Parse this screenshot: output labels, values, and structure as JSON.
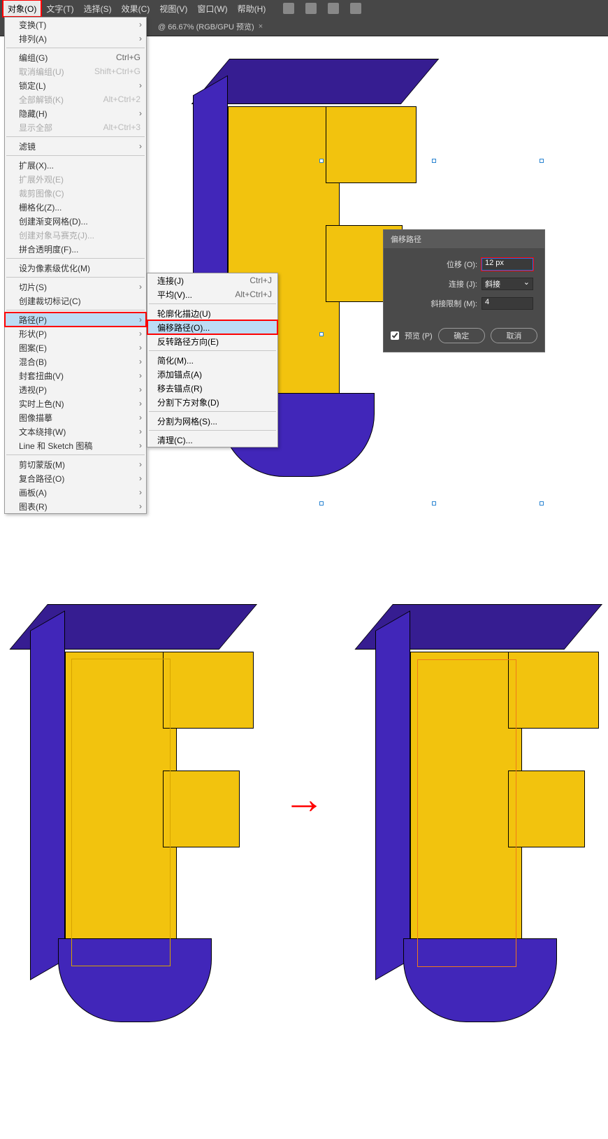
{
  "menubar": {
    "items": [
      "对象(O)",
      "文字(T)",
      "选择(S)",
      "效果(C)",
      "视图(V)",
      "窗口(W)",
      "帮助(H)"
    ]
  },
  "tab": {
    "label": "@ 66.67% (RGB/GPU 预览)",
    "close": "×"
  },
  "dropdown": {
    "items": [
      {
        "label": "变换(T)",
        "arrow": true
      },
      {
        "label": "排列(A)",
        "arrow": true
      },
      {
        "sep": true
      },
      {
        "label": "编组(G)",
        "sc": "Ctrl+G"
      },
      {
        "label": "取消编组(U)",
        "sc": "Shift+Ctrl+G",
        "disabled": true
      },
      {
        "label": "锁定(L)",
        "arrow": true
      },
      {
        "label": "全部解锁(K)",
        "sc": "Alt+Ctrl+2",
        "disabled": true
      },
      {
        "label": "隐藏(H)",
        "arrow": true
      },
      {
        "label": "显示全部",
        "sc": "Alt+Ctrl+3",
        "disabled": true
      },
      {
        "sep": true
      },
      {
        "label": "滤镜",
        "arrow": true
      },
      {
        "sep": true
      },
      {
        "label": "扩展(X)..."
      },
      {
        "label": "扩展外观(E)",
        "disabled": true
      },
      {
        "label": "裁剪图像(C)",
        "disabled": true
      },
      {
        "label": "栅格化(Z)..."
      },
      {
        "label": "创建渐变网格(D)..."
      },
      {
        "label": "创建对象马赛克(J)...",
        "disabled": true
      },
      {
        "label": "拼合透明度(F)..."
      },
      {
        "sep": true
      },
      {
        "label": "设为像素级优化(M)"
      },
      {
        "sep": true
      },
      {
        "label": "切片(S)",
        "arrow": true
      },
      {
        "label": "创建裁切标记(C)"
      },
      {
        "sep": true
      },
      {
        "label": "路径(P)",
        "arrow": true,
        "hover": true,
        "highlight": true
      },
      {
        "label": "形状(P)",
        "arrow": true
      },
      {
        "label": "图案(E)",
        "arrow": true
      },
      {
        "label": "混合(B)",
        "arrow": true
      },
      {
        "label": "封套扭曲(V)",
        "arrow": true
      },
      {
        "label": "透视(P)",
        "arrow": true
      },
      {
        "label": "实时上色(N)",
        "arrow": true
      },
      {
        "label": "图像描摹",
        "arrow": true
      },
      {
        "label": "文本绕排(W)",
        "arrow": true
      },
      {
        "label": "Line 和 Sketch 图稿",
        "arrow": true
      },
      {
        "sep": true
      },
      {
        "label": "剪切蒙版(M)",
        "arrow": true
      },
      {
        "label": "复合路径(O)",
        "arrow": true
      },
      {
        "label": "画板(A)",
        "arrow": true
      },
      {
        "label": "图表(R)",
        "arrow": true
      }
    ]
  },
  "submenu": {
    "items": [
      {
        "label": "连接(J)",
        "sc": "Ctrl+J"
      },
      {
        "label": "平均(V)...",
        "sc": "Alt+Ctrl+J"
      },
      {
        "sep": true
      },
      {
        "label": "轮廓化描边(U)"
      },
      {
        "label": "偏移路径(O)...",
        "hover": true,
        "highlight": true
      },
      {
        "label": "反转路径方向(E)"
      },
      {
        "sep": true
      },
      {
        "label": "简化(M)..."
      },
      {
        "label": "添加锚点(A)"
      },
      {
        "label": "移去锚点(R)"
      },
      {
        "label": "分割下方对象(D)"
      },
      {
        "sep": true
      },
      {
        "label": "分割为网格(S)..."
      },
      {
        "sep": true
      },
      {
        "label": "清理(C)..."
      }
    ]
  },
  "dialog": {
    "title": "偏移路径",
    "offset_label": "位移 (O):",
    "offset_value": "12 px",
    "join_label": "连接 (J):",
    "join_value": "斜接",
    "miter_label": "斜接限制 (M):",
    "miter_value": "4",
    "preview_label": "预览 (P)",
    "ok": "确定",
    "cancel": "取消"
  },
  "arrow_glyph": "→"
}
